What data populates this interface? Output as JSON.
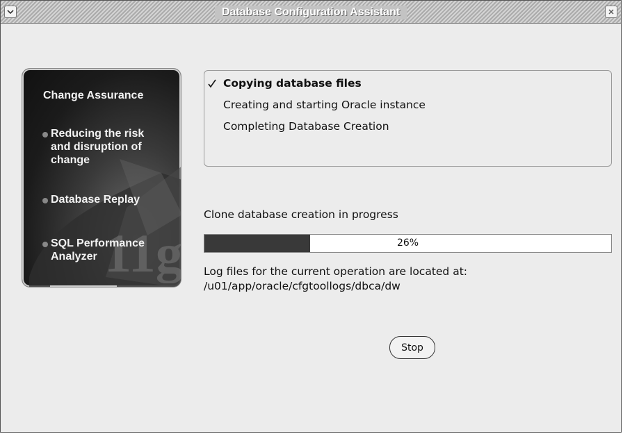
{
  "window": {
    "title": "Database Configuration Assistant"
  },
  "titlebar_icons": {
    "menu": "chevron-down-icon",
    "close": "close-icon"
  },
  "left_panel": {
    "heading": "Change Assurance",
    "items": [
      {
        "label": "Reducing the risk\nand disruption of\nchange"
      },
      {
        "label": "Database Replay"
      },
      {
        "label": "SQL Performance\nAnalyzer"
      }
    ],
    "badge": "11g"
  },
  "steps": [
    {
      "label": "Copying database files",
      "current": true
    },
    {
      "label": "Creating and starting Oracle instance",
      "current": false
    },
    {
      "label": "Completing Database Creation",
      "current": false
    }
  ],
  "status": "Clone database creation in progress",
  "progress": {
    "percent": 26,
    "label": "26%"
  },
  "log": {
    "line1": "Log files for the current operation are located at:",
    "line2": "/u01/app/oracle/cfgtoollogs/dbca/dw"
  },
  "stop_label": "Stop"
}
